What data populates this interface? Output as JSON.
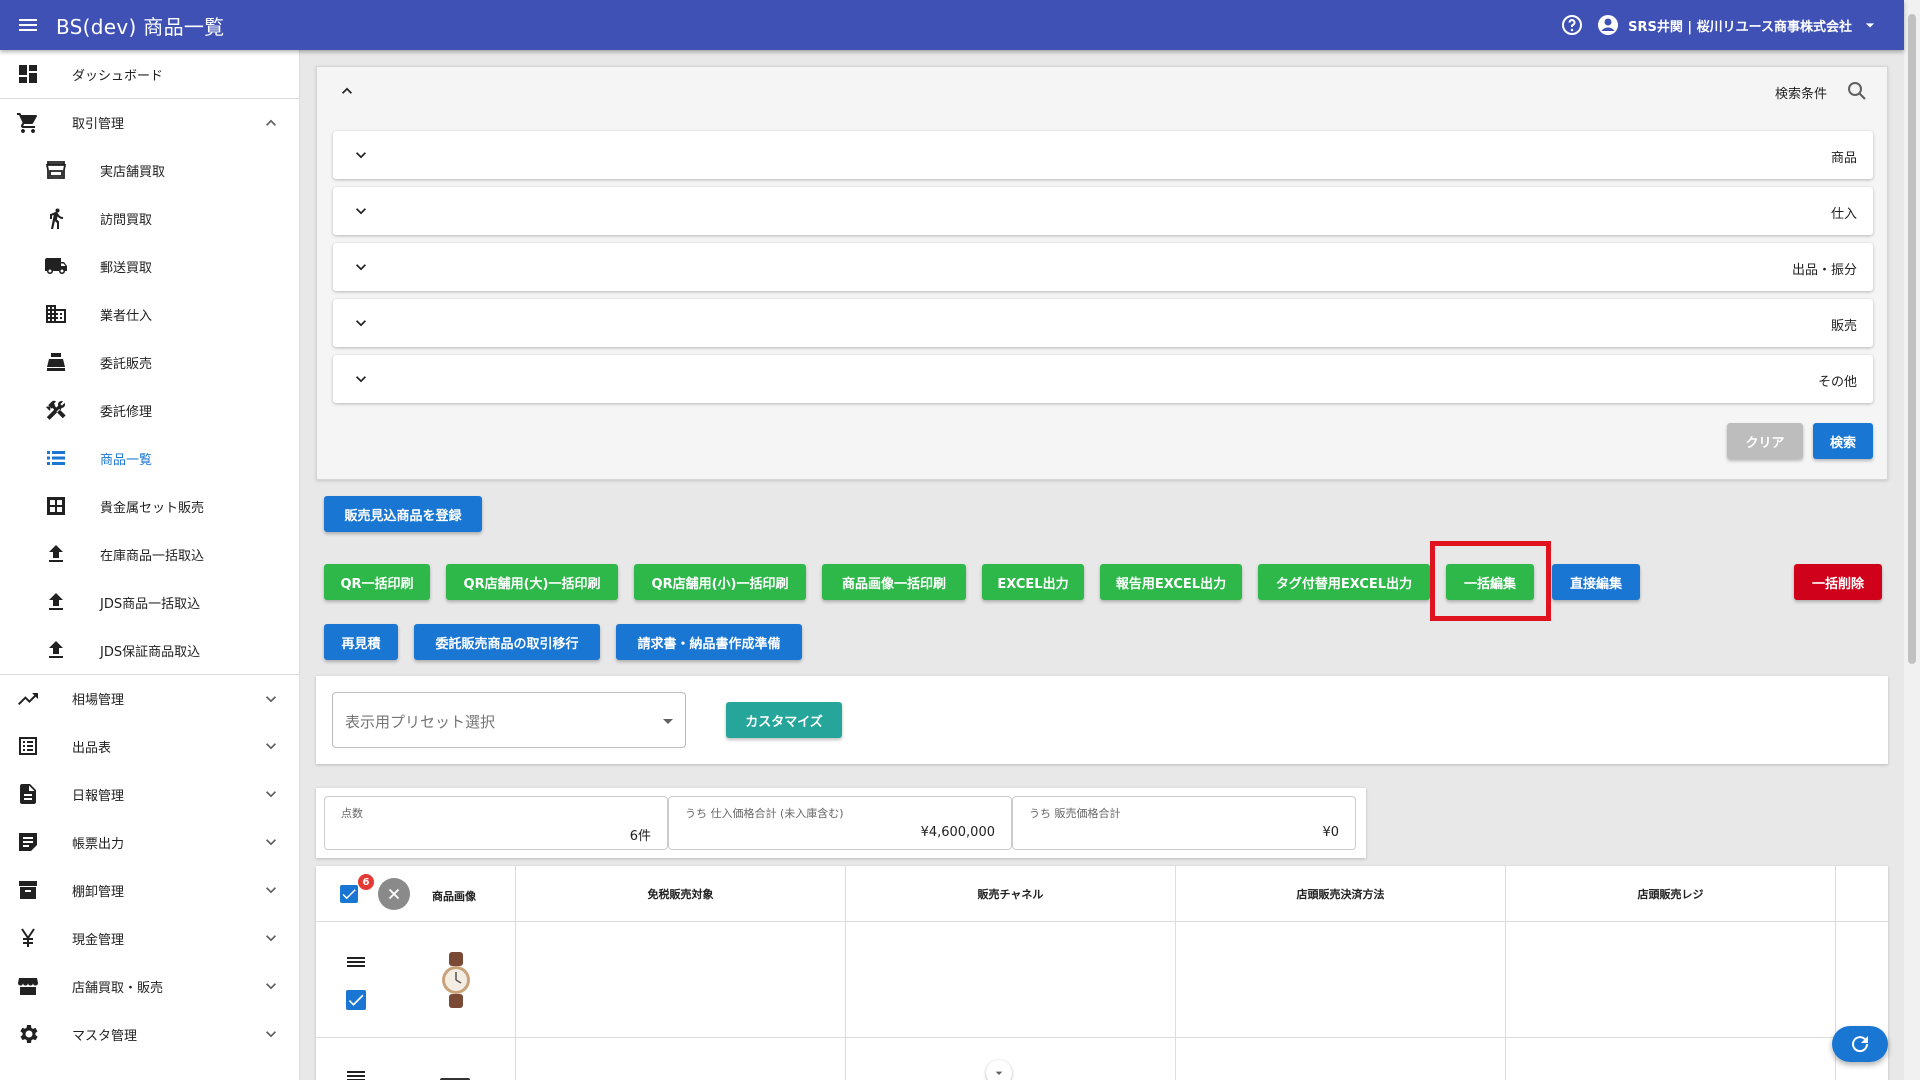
{
  "header": {
    "title": "BS(dev) 商品一覧",
    "user": "SRS井関 | 桜川リユース商事株式会社"
  },
  "sidebar": {
    "items": [
      {
        "label": "ダッシュボード"
      },
      {
        "label": "取引管理"
      },
      {
        "label": "実店舗買取"
      },
      {
        "label": "訪問買取"
      },
      {
        "label": "郵送買取"
      },
      {
        "label": "業者仕入"
      },
      {
        "label": "委託販売"
      },
      {
        "label": "委託修理"
      },
      {
        "label": "商品一覧"
      },
      {
        "label": "貴金属セット販売"
      },
      {
        "label": "在庫商品一括取込"
      },
      {
        "label": "JDS商品一括取込"
      },
      {
        "label": "JDS保証商品取込"
      },
      {
        "label": "相場管理"
      },
      {
        "label": "出品表"
      },
      {
        "label": "日報管理"
      },
      {
        "label": "帳票出力"
      },
      {
        "label": "棚卸管理"
      },
      {
        "label": "現金管理"
      },
      {
        "label": "店舗買取・販売"
      },
      {
        "label": "マスタ管理"
      }
    ]
  },
  "search": {
    "title": "検索条件",
    "sections": [
      "商品",
      "仕入",
      "出品・振分",
      "販売",
      "その他"
    ],
    "clear_label": "クリア",
    "search_label": "検索"
  },
  "actions": {
    "register_label": "販売見込商品を登録",
    "row1": [
      "QR一括印刷",
      "QR店舗用(大)一括印刷",
      "QR店舗用(小)一括印刷",
      "商品画像一括印刷",
      "EXCEL出力",
      "報告用EXCEL出力",
      "タグ付替用EXCEL出力",
      "一括編集"
    ],
    "direct_edit_label": "直接編集",
    "bulk_delete_label": "一括削除",
    "row2": [
      "再見積",
      "委託販売商品の取引移行",
      "請求書・納品書作成準備"
    ]
  },
  "preset": {
    "placeholder": "表示用プリセット選択",
    "customize_label": "カスタマイズ"
  },
  "summary": [
    {
      "caption": "点数",
      "value": "6件"
    },
    {
      "caption": "うち 仕入価格合計 (未入庫含む)",
      "value": "¥4,600,000"
    },
    {
      "caption": "うち 販売価格合計",
      "value": "¥0"
    }
  ],
  "table": {
    "badge": "6",
    "columns": [
      "商品画像",
      "免税販売対象",
      "販売チャネル",
      "店頭販売決済方法",
      "店頭販売レジ"
    ]
  },
  "colors": {
    "appbar": "#3f51b5",
    "green": "#2eb84a",
    "blue": "#1976d2",
    "red": "#d0021b",
    "highlight": "#e0141e"
  }
}
